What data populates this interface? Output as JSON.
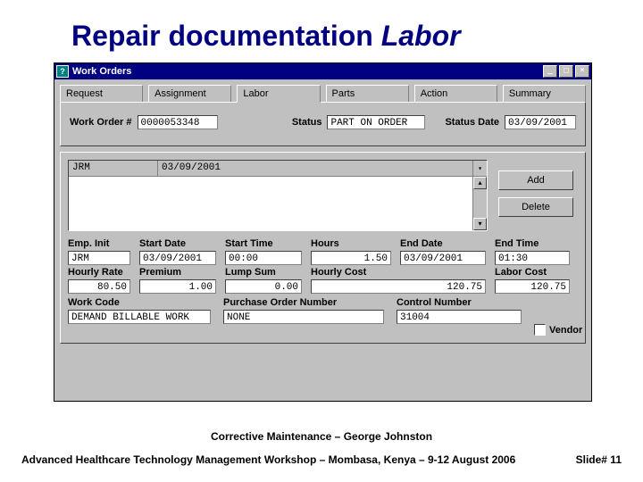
{
  "slide": {
    "title_a": "Repair documentation ",
    "title_b": "Labor"
  },
  "window": {
    "title": "Work Orders"
  },
  "tabs": {
    "request": "Request",
    "assignment": "Assignment",
    "labor": "Labor",
    "parts": "Parts",
    "action": "Action",
    "summary": "Summary",
    "active": "labor"
  },
  "header": {
    "work_order_label": "Work Order #",
    "work_order_value": "0000053348",
    "status_label": "Status",
    "status_value": "PART ON ORDER",
    "status_date_label": "Status Date",
    "status_date_value": "03/09/2001"
  },
  "list": {
    "col1": "JRM",
    "col2": "03/09/2001",
    "buttons": {
      "add": "Add",
      "delete": "Delete"
    }
  },
  "fields": {
    "emp_init": {
      "label": "Emp. Init",
      "value": "JRM"
    },
    "start_date": {
      "label": "Start Date",
      "value": "03/09/2001"
    },
    "start_time": {
      "label": "Start Time",
      "value": "00:00"
    },
    "hours": {
      "label": "Hours",
      "value": "1.50"
    },
    "end_date": {
      "label": "End Date",
      "value": "03/09/2001"
    },
    "end_time": {
      "label": "End Time",
      "value": "01:30"
    },
    "hourly_rate": {
      "label": "Hourly Rate",
      "value": "80.50"
    },
    "premium": {
      "label": "Premium",
      "value": "1.00"
    },
    "lump_sum": {
      "label": "Lump Sum",
      "value": "0.00"
    },
    "hourly_cost": {
      "label": "Hourly Cost",
      "value": "120.75"
    },
    "labor_cost": {
      "label": "Labor Cost",
      "value": "120.75"
    },
    "work_code": {
      "label": "Work Code",
      "value": "DEMAND BILLABLE WORK"
    },
    "po_number": {
      "label": "Purchase Order Number",
      "value": "NONE"
    },
    "control_number": {
      "label": "Control Number",
      "value": "31004"
    },
    "vendor": {
      "label": "Vendor",
      "checked": false
    }
  },
  "footer": {
    "line1": "Corrective Maintenance – George Johnston",
    "line2": "Advanced Healthcare Technology Management Workshop – Mombasa, Kenya – 9-12 August 2006",
    "slide_num": "Slide# 11"
  }
}
